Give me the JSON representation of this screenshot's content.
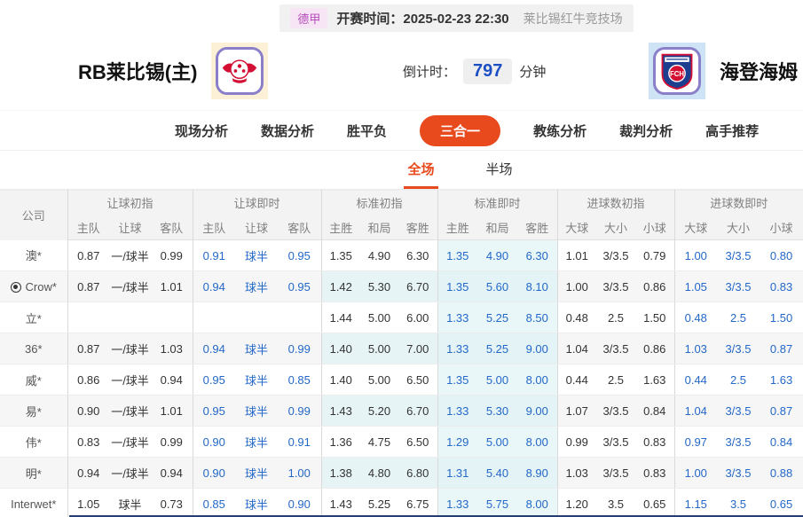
{
  "top_bar": {
    "league_badge": "德甲",
    "kickoff_label": "开赛时间：",
    "kickoff_time": "2025-02-23 22:30",
    "venue": "莱比锡红牛竞技场"
  },
  "match_header": {
    "home_team": "RB莱比锡(主)",
    "away_team": "海登海姆",
    "away_logo_text": "FCH",
    "countdown_label": "倒计时：",
    "countdown_value": "797",
    "countdown_unit": "分钟"
  },
  "nav_tabs": [
    {
      "label": "现场分析",
      "active": false
    },
    {
      "label": "数据分析",
      "active": false
    },
    {
      "label": "胜平负",
      "active": false
    },
    {
      "label": "三合一",
      "active": true
    },
    {
      "label": "教练分析",
      "active": false
    },
    {
      "label": "裁判分析",
      "active": false
    },
    {
      "label": "高手推荐",
      "active": false
    }
  ],
  "sub_tabs": [
    {
      "label": "全场",
      "active": true
    },
    {
      "label": "半场",
      "active": false
    }
  ],
  "table": {
    "company_header": "公司",
    "groups": [
      {
        "label": "让球初指",
        "cols": [
          "主队",
          "让球",
          "客队"
        ]
      },
      {
        "label": "让球即时",
        "cols": [
          "主队",
          "让球",
          "客队"
        ]
      },
      {
        "label": "标准初指",
        "cols": [
          "主胜",
          "和局",
          "客胜"
        ]
      },
      {
        "label": "标准即时",
        "cols": [
          "主胜",
          "和局",
          "客胜"
        ]
      },
      {
        "label": "进球数初指",
        "cols": [
          "大球",
          "大小",
          "小球"
        ]
      },
      {
        "label": "进球数即时",
        "cols": [
          "大球",
          "大小",
          "小球"
        ]
      }
    ],
    "rows": [
      {
        "company": "澳*",
        "has_icon": false,
        "cells": [
          "0.87",
          "一/球半",
          "0.99",
          "0.91",
          "球半",
          "0.95",
          "1.35",
          "4.90",
          "6.30",
          "1.35",
          "4.90",
          "6.30",
          "1.01",
          "3/3.5",
          "0.79",
          "1.00",
          "3/3.5",
          "0.80"
        ]
      },
      {
        "company": "Crow*",
        "has_icon": true,
        "cells": [
          "0.87",
          "一/球半",
          "1.01",
          "0.94",
          "球半",
          "0.95",
          "1.42",
          "5.30",
          "6.70",
          "1.35",
          "5.60",
          "8.10",
          "1.00",
          "3/3.5",
          "0.86",
          "1.05",
          "3/3.5",
          "0.83"
        ]
      },
      {
        "company": "立*",
        "has_icon": false,
        "cells": [
          "",
          "",
          "",
          "",
          "",
          "",
          "1.44",
          "5.00",
          "6.00",
          "1.33",
          "5.25",
          "8.50",
          "0.48",
          "2.5",
          "1.50",
          "0.48",
          "2.5",
          "1.50"
        ]
      },
      {
        "company": "36*",
        "has_icon": false,
        "cells": [
          "0.87",
          "一/球半",
          "1.03",
          "0.94",
          "球半",
          "0.99",
          "1.40",
          "5.00",
          "7.00",
          "1.33",
          "5.25",
          "9.00",
          "1.04",
          "3/3.5",
          "0.86",
          "1.03",
          "3/3.5",
          "0.87"
        ]
      },
      {
        "company": "威*",
        "has_icon": false,
        "cells": [
          "0.86",
          "一/球半",
          "0.94",
          "0.95",
          "球半",
          "0.85",
          "1.40",
          "5.00",
          "6.50",
          "1.35",
          "5.00",
          "8.00",
          "0.44",
          "2.5",
          "1.63",
          "0.44",
          "2.5",
          "1.63"
        ]
      },
      {
        "company": "易*",
        "has_icon": false,
        "cells": [
          "0.90",
          "一/球半",
          "1.01",
          "0.95",
          "球半",
          "0.99",
          "1.43",
          "5.20",
          "6.70",
          "1.33",
          "5.30",
          "9.00",
          "1.07",
          "3/3.5",
          "0.84",
          "1.04",
          "3/3.5",
          "0.87"
        ]
      },
      {
        "company": "伟*",
        "has_icon": false,
        "cells": [
          "0.83",
          "一/球半",
          "0.99",
          "0.90",
          "球半",
          "0.91",
          "1.36",
          "4.75",
          "6.50",
          "1.29",
          "5.00",
          "8.00",
          "0.99",
          "3/3.5",
          "0.83",
          "0.97",
          "3/3.5",
          "0.84"
        ]
      },
      {
        "company": "明*",
        "has_icon": false,
        "cells": [
          "0.94",
          "一/球半",
          "0.94",
          "0.90",
          "球半",
          "1.00",
          "1.38",
          "4.80",
          "6.80",
          "1.31",
          "5.40",
          "8.90",
          "1.03",
          "3/3.5",
          "0.83",
          "1.00",
          "3/3.5",
          "0.88"
        ]
      },
      {
        "company": "Interwet*",
        "has_icon": false,
        "cells": [
          "1.05",
          "球半",
          "0.73",
          "0.85",
          "球半",
          "0.90",
          "1.43",
          "5.25",
          "6.75",
          "1.33",
          "5.75",
          "8.00",
          "1.20",
          "3.5",
          "0.65",
          "1.15",
          "3.5",
          "0.65"
        ]
      }
    ]
  },
  "colors": {
    "accent_orange": "#e8491d",
    "odds_live_blue": "#2468c8",
    "countdown_blue": "#1d4fc4",
    "league_badge_bg": "#f7e4f5",
    "league_badge_text": "#b44dbb",
    "home_tile_bg": "#fcf0d6",
    "away_tile_bg": "#cfe3f6",
    "std_live_bg": "#e9f7f9",
    "footer_bar_navy": "#23406f"
  }
}
